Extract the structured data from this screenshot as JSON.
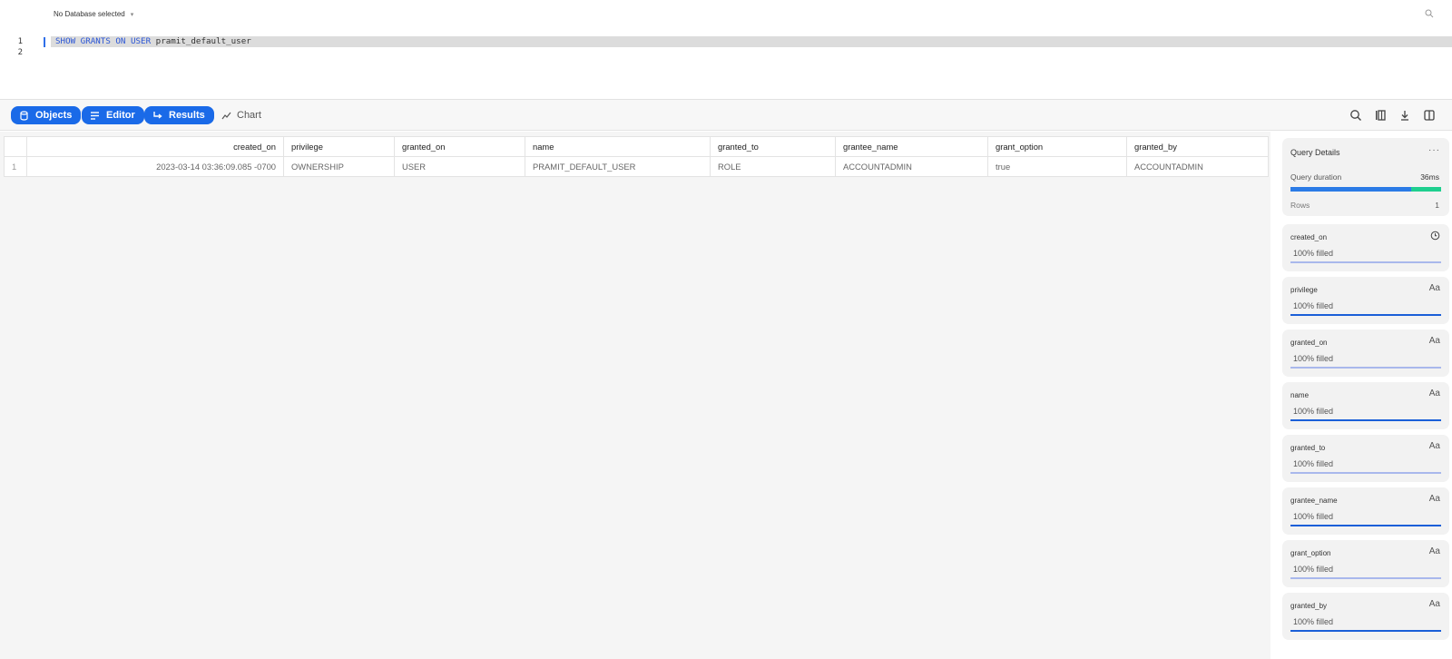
{
  "topbar": {
    "database_selector": "No Database selected",
    "caret": "▾"
  },
  "editor": {
    "line_numbers": [
      "1",
      "2"
    ],
    "line1": {
      "keywords": "SHOW GRANTS ON USER",
      "identifier": "pramit_default_user"
    }
  },
  "toolbar": {
    "objects_label": "Objects",
    "editor_label": "Editor",
    "results_label": "Results",
    "chart_label": "Chart",
    "accent": "#1a6ae8"
  },
  "results": {
    "columns": [
      "created_on",
      "privilege",
      "granted_on",
      "name",
      "granted_to",
      "grantee_name",
      "grant_option",
      "granted_by"
    ],
    "rows": [
      {
        "index": "1",
        "values": [
          "2023-03-14 03:36:09.085 -0700",
          "OWNERSHIP",
          "USER",
          "PRAMIT_DEFAULT_USER",
          "ROLE",
          "ACCOUNTADMIN",
          "true",
          "ACCOUNTADMIN"
        ]
      }
    ]
  },
  "query_details": {
    "title": "Query Details",
    "more": "···",
    "duration_label": "Query duration",
    "duration_value": "36ms",
    "duration_split": {
      "compile_fraction": 0.8,
      "compile_color": "#2b7be6",
      "exec_color": "#1fcf8f"
    },
    "rows_label": "Rows",
    "rows_value": "1"
  },
  "column_stats": [
    {
      "name": "created_on",
      "type_icon": "clock",
      "fill": "100% filled",
      "bar_color": "#a9b8ec"
    },
    {
      "name": "privilege",
      "type_icon": "Aa",
      "fill": "100% filled",
      "bar_color": "#1a5fd8"
    },
    {
      "name": "granted_on",
      "type_icon": "Aa",
      "fill": "100% filled",
      "bar_color": "#a9b8ec"
    },
    {
      "name": "name",
      "type_icon": "Aa",
      "fill": "100% filled",
      "bar_color": "#1a5fd8"
    },
    {
      "name": "granted_to",
      "type_icon": "Aa",
      "fill": "100% filled",
      "bar_color": "#a9b8ec"
    },
    {
      "name": "grantee_name",
      "type_icon": "Aa",
      "fill": "100% filled",
      "bar_color": "#1a5fd8"
    },
    {
      "name": "grant_option",
      "type_icon": "Aa",
      "fill": "100% filled",
      "bar_color": "#a9b8ec"
    },
    {
      "name": "granted_by",
      "type_icon": "Aa",
      "fill": "100% filled",
      "bar_color": "#1a5fd8"
    }
  ]
}
